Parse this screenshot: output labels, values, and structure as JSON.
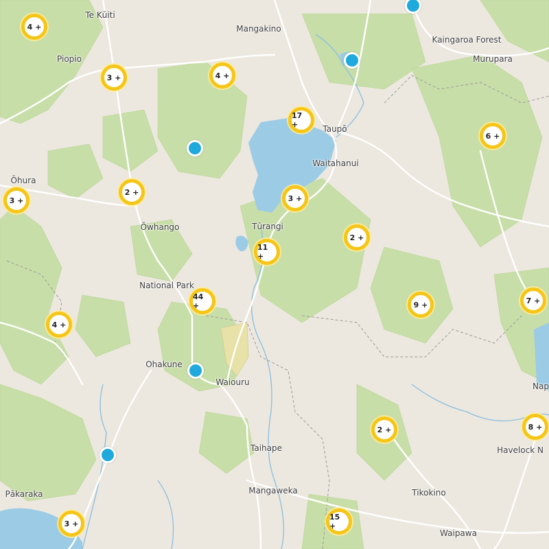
{
  "map": {
    "colors": {
      "land": "#ece8df",
      "forest": "#c8dea8",
      "water": "#9ccbe6",
      "reserve": "#e8e1a8",
      "road": "#ffffff",
      "river": "#8ebfe0",
      "boundary": "#9a9a9a",
      "cluster_ring": "#f5c518",
      "marker": "#1fa9dc"
    },
    "places": [
      {
        "id": "te-kuiti",
        "name": "Te Kūiti"
      },
      {
        "id": "mangakino",
        "name": "Mangakino"
      },
      {
        "id": "kaingaroa-forest",
        "name": "Kaingaroa Forest"
      },
      {
        "id": "murupara",
        "name": "Murupara"
      },
      {
        "id": "piopio",
        "name": "Piopio"
      },
      {
        "id": "taupo",
        "name": "Taupō"
      },
      {
        "id": "waitahanui",
        "name": "Waitahanui"
      },
      {
        "id": "ohura",
        "name": "Ōhura"
      },
      {
        "id": "owhango",
        "name": "Ōwhango"
      },
      {
        "id": "turangi",
        "name": "Tūrangi"
      },
      {
        "id": "national-park",
        "name": "National Park"
      },
      {
        "id": "ohakune",
        "name": "Ohakune"
      },
      {
        "id": "waiouru",
        "name": "Waiouru"
      },
      {
        "id": "taihape",
        "name": "Taihape"
      },
      {
        "id": "napier",
        "name": "Nap"
      },
      {
        "id": "havelock-north",
        "name": "Havelock N"
      },
      {
        "id": "pakaraka",
        "name": "Pākaraka"
      },
      {
        "id": "mangaweka",
        "name": "Mangaweka"
      },
      {
        "id": "tikokino",
        "name": "Tikokino"
      },
      {
        "id": "waipawa",
        "name": "Waipawa"
      }
    ],
    "clusters": [
      {
        "label": "4 +"
      },
      {
        "label": "3 +"
      },
      {
        "label": "4 +"
      },
      {
        "label": "17 +"
      },
      {
        "label": "6 +"
      },
      {
        "label": "3 +"
      },
      {
        "label": "2 +"
      },
      {
        "label": "3 +"
      },
      {
        "label": "2 +"
      },
      {
        "label": "11 +"
      },
      {
        "label": "44 +"
      },
      {
        "label": "9 +"
      },
      {
        "label": "7 +"
      },
      {
        "label": "4 +"
      },
      {
        "label": "2 +"
      },
      {
        "label": "8 +"
      },
      {
        "label": "3 +"
      },
      {
        "label": "15 +"
      }
    ],
    "markers": [
      {
        "id": "marker-1"
      },
      {
        "id": "marker-2"
      },
      {
        "id": "marker-3"
      },
      {
        "id": "marker-4"
      },
      {
        "id": "marker-5"
      }
    ]
  }
}
